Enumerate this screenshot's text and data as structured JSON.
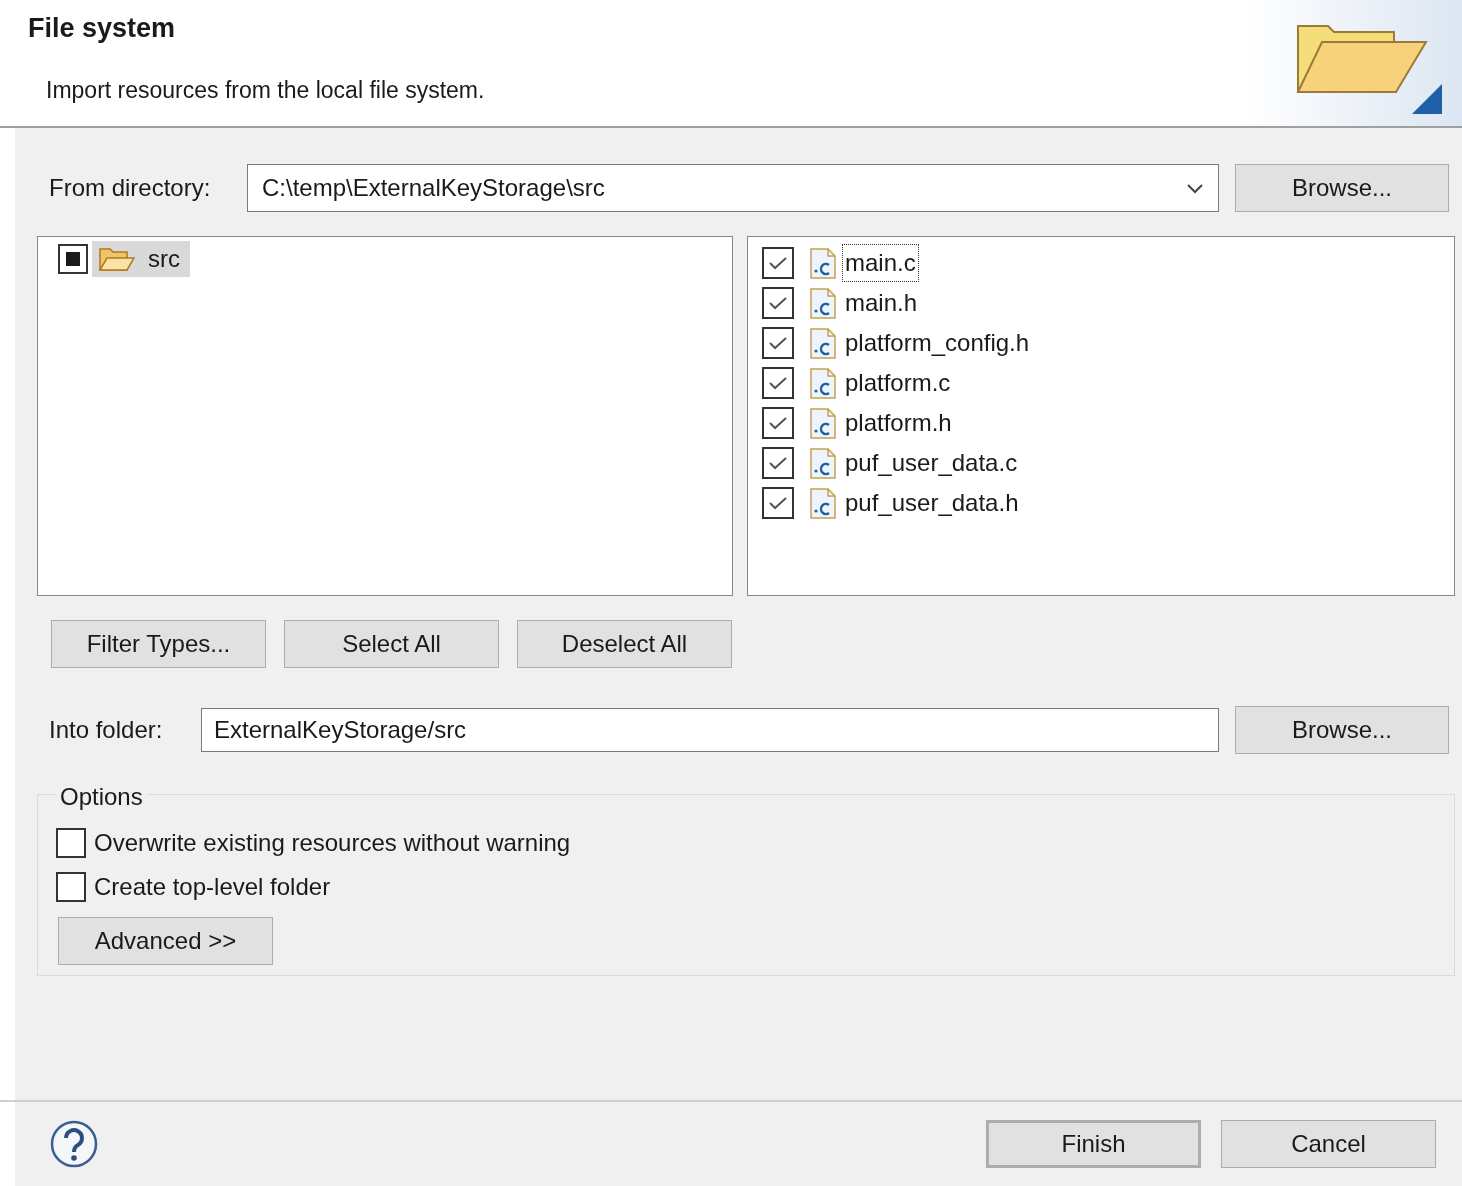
{
  "header": {
    "title": "File system",
    "description": "Import resources from the local file system."
  },
  "from_directory": {
    "label": "From directory:",
    "value": "C:\\temp\\ExternalKeyStorage\\src",
    "browse": "Browse..."
  },
  "tree": [
    {
      "label": "src",
      "checked": true,
      "grayed": true,
      "selected": true
    }
  ],
  "files": [
    {
      "name": "main.c",
      "checked": true,
      "focused": true
    },
    {
      "name": "main.h",
      "checked": true,
      "focused": false
    },
    {
      "name": "platform_config.h",
      "checked": true,
      "focused": false
    },
    {
      "name": "platform.c",
      "checked": true,
      "focused": false
    },
    {
      "name": "platform.h",
      "checked": true,
      "focused": false
    },
    {
      "name": "puf_user_data.c",
      "checked": true,
      "focused": false
    },
    {
      "name": "puf_user_data.h",
      "checked": true,
      "focused": false
    }
  ],
  "selection_buttons": [
    "Filter Types...",
    "Select All",
    "Deselect All"
  ],
  "into_folder": {
    "label": "Into folder:",
    "value": "ExternalKeyStorage/src",
    "browse": "Browse..."
  },
  "options": {
    "title": "Options",
    "checkboxes": [
      {
        "label": "Overwrite existing resources without warning",
        "checked": false
      },
      {
        "label": "Create top-level folder",
        "checked": false
      }
    ],
    "advanced": "Advanced >>"
  },
  "footer": {
    "buttons": [
      {
        "label": "Finish",
        "default": true
      },
      {
        "label": "Cancel",
        "default": false
      }
    ]
  }
}
